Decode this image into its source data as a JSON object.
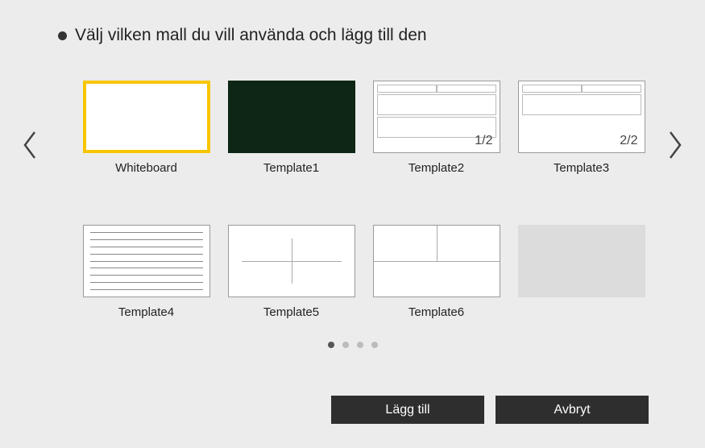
{
  "title": "Välj vilken mall du vill använda och lägg till den",
  "templates": [
    {
      "label": "Whiteboard"
    },
    {
      "label": "Template1"
    },
    {
      "label": "Template2",
      "page": "1/2"
    },
    {
      "label": "Template3",
      "page": "2/2"
    },
    {
      "label": "Template4"
    },
    {
      "label": "Template5"
    },
    {
      "label": "Template6"
    },
    {
      "label": ""
    }
  ],
  "pagination": {
    "count": 4,
    "active": 0
  },
  "buttons": {
    "add": "Lägg till",
    "cancel": "Avbryt"
  }
}
